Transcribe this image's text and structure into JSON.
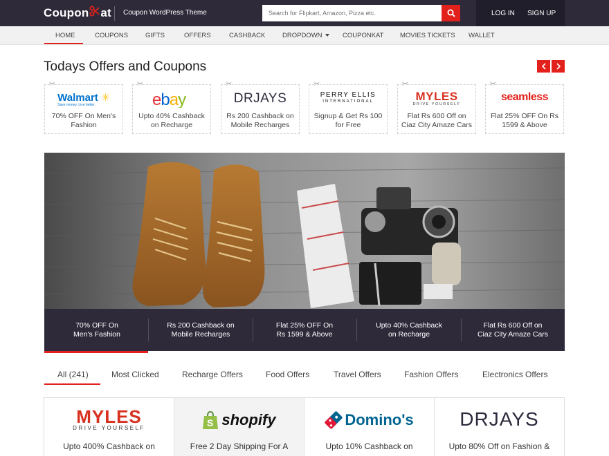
{
  "header": {
    "logo_left": "Coupon",
    "logo_right": "at",
    "tagline": "Coupon WordPress Theme",
    "search_placeholder": "Search for Flipkart, Amazon, Pizza etc.",
    "login_label": "LOG IN",
    "signup_label": "SIGN UP",
    "colors": {
      "dark": "#2e2a3a",
      "accent": "#e2211c"
    }
  },
  "nav": {
    "items": [
      "HOME",
      "COUPONS",
      "GIFTS",
      "OFFERS",
      "CASHBACK",
      "DROPDOWN",
      "COUPONKAT",
      "MOVIES TICKETS",
      "WALLET"
    ],
    "active": "HOME"
  },
  "offers_section": {
    "title": "Todays Offers and Coupons",
    "cards": [
      {
        "brand": "Walmart",
        "brand_tag": "Save money. Live better.",
        "desc": "70% OFF On Men's Fashion"
      },
      {
        "brand": "ebay",
        "desc": "Upto 40% Cashback on Recharge"
      },
      {
        "brand": "DRJAYS",
        "desc": "Rs 200 Cashback on Mobile Recharges"
      },
      {
        "brand": "PERRY ELLIS",
        "brand_tag": "INTERNATIONAL",
        "desc": "Signup & Get Rs 100 for Free"
      },
      {
        "brand": "MYLES",
        "brand_tag": "DRIVE YOURSELF",
        "desc": "Flat Rs 600 Off on Ciaz City Amaze Cars"
      },
      {
        "brand": "seamless",
        "desc": "Flat 25% OFF On Rs 1599 & Above"
      }
    ]
  },
  "slider": {
    "tabs": [
      "70% OFF On Men's Fashion",
      "Rs 200 Cashback on Mobile Recharges",
      "Flat 25% OFF On Rs 1599 & Above",
      "Upto 40% Cashback on Recharge",
      "Flat Rs 600 Off on Ciaz City Amaze Cars"
    ],
    "active_index": 0
  },
  "categories": {
    "tabs": [
      "All (241)",
      "Most Clicked",
      "Recharge Offers",
      "Food Offers",
      "Travel Offers",
      "Fashion Offers",
      "Electronics Offers"
    ],
    "active_index": 0
  },
  "stores": [
    {
      "brand": "MYLES",
      "brand_tag": "DRIVE YOURSELF",
      "desc": "Upto 400% Cashback on"
    },
    {
      "brand": "shopify",
      "desc": "Free 2 Day Shipping For A"
    },
    {
      "brand": "Domino's",
      "desc": "Upto 10% Cashback on"
    },
    {
      "brand": "DRJAYS",
      "desc": "Upto 80% Off on Fashion &"
    }
  ]
}
